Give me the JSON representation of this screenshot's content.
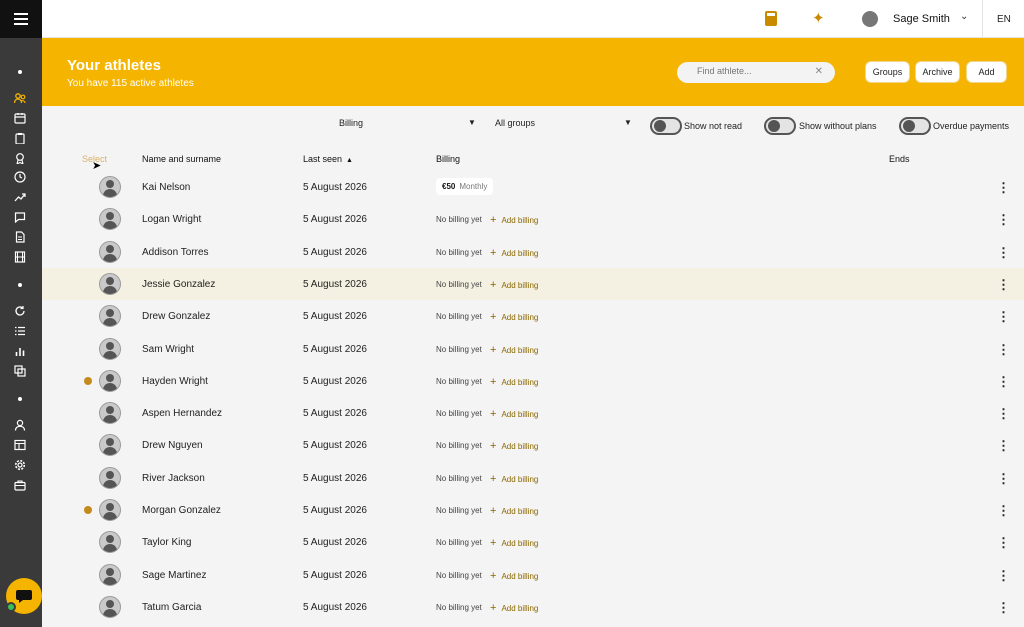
{
  "topbar": {
    "username": "Sage Smith",
    "language": "EN"
  },
  "hero": {
    "title": "Your athletes",
    "subtitle": "You have 115 active athletes",
    "search_placeholder": "Find athlete...",
    "buttons": {
      "groups": "Groups",
      "archive": "Archive",
      "add": "Add"
    }
  },
  "filters": {
    "billing": "Billing",
    "groups": "All groups",
    "toggles": [
      "Show not read",
      "Show without plans",
      "Overdue payments"
    ]
  },
  "table": {
    "headers": {
      "select": "Select",
      "name": "Name and surname",
      "last_seen": "Last seen",
      "billing": "Billing",
      "ends": "Ends"
    },
    "no_billing_text": "No billing yet",
    "add_billing_text": "Add billing",
    "rows": [
      {
        "name": "Kai Nelson",
        "last_seen": "5 August 2026",
        "billing": {
          "amount": "€50",
          "period": "Monthly"
        },
        "warning": false,
        "highlighted": false
      },
      {
        "name": "Logan Wright",
        "last_seen": "5 August 2026",
        "billing": null,
        "warning": false,
        "highlighted": false
      },
      {
        "name": "Addison Torres",
        "last_seen": "5 August 2026",
        "billing": null,
        "warning": false,
        "highlighted": false
      },
      {
        "name": "Jessie Gonzalez",
        "last_seen": "5 August 2026",
        "billing": null,
        "warning": false,
        "highlighted": true
      },
      {
        "name": "Drew Gonzalez",
        "last_seen": "5 August 2026",
        "billing": null,
        "warning": false,
        "highlighted": false
      },
      {
        "name": "Sam Wright",
        "last_seen": "5 August 2026",
        "billing": null,
        "warning": false,
        "highlighted": false
      },
      {
        "name": "Hayden Wright",
        "last_seen": "5 August 2026",
        "billing": null,
        "warning": true,
        "highlighted": false
      },
      {
        "name": "Aspen Hernandez",
        "last_seen": "5 August 2026",
        "billing": null,
        "warning": false,
        "highlighted": false
      },
      {
        "name": "Drew Nguyen",
        "last_seen": "5 August 2026",
        "billing": null,
        "warning": false,
        "highlighted": false
      },
      {
        "name": "River Jackson",
        "last_seen": "5 August 2026",
        "billing": null,
        "warning": false,
        "highlighted": false
      },
      {
        "name": "Morgan Gonzalez",
        "last_seen": "5 August 2026",
        "billing": null,
        "warning": true,
        "highlighted": false
      },
      {
        "name": "Taylor King",
        "last_seen": "5 August 2026",
        "billing": null,
        "warning": false,
        "highlighted": false
      },
      {
        "name": "Sage Martinez",
        "last_seen": "5 August 2026",
        "billing": null,
        "warning": false,
        "highlighted": false
      },
      {
        "name": "Tatum Garcia",
        "last_seen": "5 August 2026",
        "billing": null,
        "warning": false,
        "highlighted": false
      }
    ]
  },
  "sidebar": {
    "icons": [
      "dot",
      "users-icon",
      "calendar-icon",
      "clipboard-icon",
      "medal-icon",
      "clock-icon",
      "trend-icon",
      "message-icon",
      "document-icon",
      "film-icon",
      "dot",
      "refresh-icon",
      "list-icon",
      "bar-chart-icon",
      "copy-icon",
      "dot",
      "user-icon",
      "layout-icon",
      "gear-icon",
      "briefcase-icon"
    ]
  },
  "colors": {
    "accent": "#f5b400",
    "sidebar": "#3a3a3a",
    "link": "#8a6600",
    "warning": "#c48a1c"
  }
}
